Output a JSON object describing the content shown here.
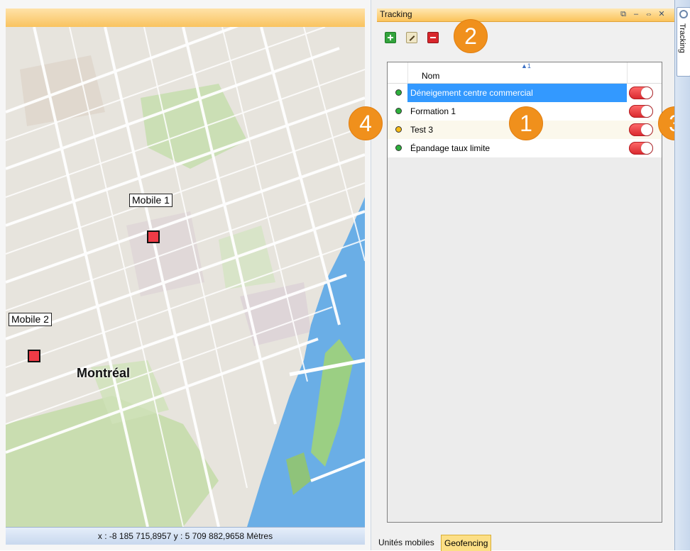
{
  "map": {
    "labels": {
      "mobile_1": "Mobile 1",
      "mobile_2": "Mobile 2",
      "city": "Montréal"
    },
    "coordinates": "x : -8 185 715,8957   y : 5 709 882,9658 Mètres"
  },
  "panel": {
    "title": "Tracking",
    "header_buttons": [
      "restore-icon",
      "minimize-icon",
      "pin-icon",
      "close-icon"
    ],
    "toolbar": [
      "add-icon",
      "edit-icon",
      "delete-icon"
    ],
    "grid": {
      "column_name": "Nom",
      "sort_indicator": "▲1",
      "rows": [
        {
          "name": "Déneigement centre commercial",
          "status_color": "#2db03c",
          "selected": true,
          "toggle": "on"
        },
        {
          "name": "Formation 1",
          "status_color": "#2db03c",
          "selected": false,
          "toggle": "on"
        },
        {
          "name": "Test 3",
          "status_color": "#f6bb16",
          "selected": false,
          "toggle": "on"
        },
        {
          "name": "Épandage taux limite",
          "status_color": "#2db03c",
          "selected": false,
          "toggle": "on"
        }
      ]
    },
    "callouts": [
      "1",
      "2",
      "3",
      "4"
    ],
    "bottom_tabs": {
      "units": "Unités mobiles",
      "geofencing": "Geofencing"
    }
  },
  "dock": {
    "tab_label": "Tracking",
    "icon": "target-icon"
  },
  "colors": {
    "accent_orange": "#f0901c",
    "selection_blue": "#3399ff",
    "toggle_red": "#e1393f",
    "water_blue": "#6aaee6",
    "park_green": "#c8deb0"
  }
}
